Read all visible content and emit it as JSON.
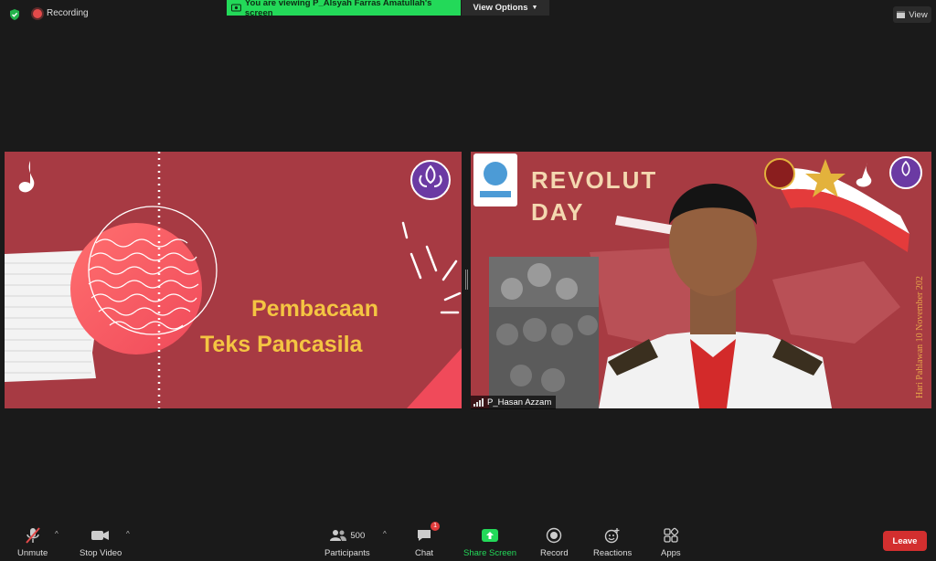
{
  "meeting": {
    "recording_label": "Recording",
    "banner_text": "You are viewing P_Alsyah Farras Amatullah's screen",
    "view_options_label": "View Options",
    "view_label": "View"
  },
  "tiles": {
    "left": {
      "title_line1": "Pembacaan",
      "title_line2": "Teks Pancasila"
    },
    "right": {
      "title_line1": "REVOLUT",
      "title_line2": "DAY",
      "side_text": "Hari Pahlawan 10 November 202",
      "participant_name": "P_Hasan Azzam"
    }
  },
  "toolbar": {
    "unmute": "Unmute",
    "stop_video": "Stop Video",
    "participants": "Participants",
    "participants_count": "500",
    "chat": "Chat",
    "chat_badge": "1",
    "share_screen": "Share Screen",
    "record": "Record",
    "reactions": "Reactions",
    "apps": "Apps",
    "leave": "Leave"
  },
  "colors": {
    "background": "#1a1a1a",
    "banner_green": "#23d959",
    "leave_red": "#d32f2f",
    "slide_maroon": "#a73a43",
    "slide_title_yellow": "#f4c542"
  },
  "icons": [
    "shield-icon",
    "record-dot-icon",
    "viewer-icon",
    "chevron-down-icon",
    "grid-view-icon",
    "muted-mic-icon",
    "camera-icon",
    "participants-icon",
    "chat-icon",
    "share-arrow-icon",
    "record-icon",
    "reactions-icon",
    "apps-icon",
    "signal-icon"
  ]
}
